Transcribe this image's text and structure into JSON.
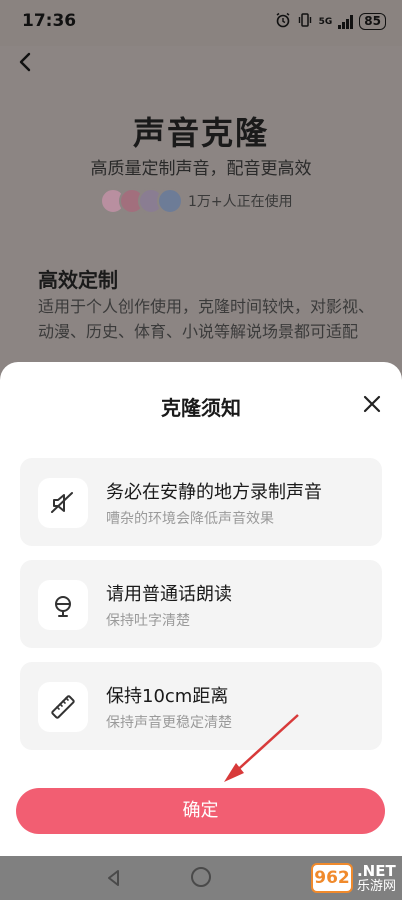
{
  "status_bar": {
    "time": "17:36",
    "network": "5G",
    "battery": "85"
  },
  "background_page": {
    "title": "声音克隆",
    "subtitle": "高质量定制声音，配音更高效",
    "users_text": "1万+人正在使用",
    "section_title": "高效定制",
    "section_desc": "适用于个人创作使用，克隆时间较快，对影视、动漫、历史、体育、小说等解说场景都可适配"
  },
  "sheet": {
    "title": "克隆须知",
    "cards": [
      {
        "icon": "muted-speaker-icon",
        "title": "务必在安静的地方录制声音",
        "subtitle": "嘈杂的环境会降低声音效果"
      },
      {
        "icon": "microphone-icon",
        "title": "请用普通话朗读",
        "subtitle": "保持吐字清楚"
      },
      {
        "icon": "ruler-icon",
        "title": "保持10cm距离",
        "subtitle": "保持声音更稳定清楚"
      }
    ],
    "confirm_label": "确定"
  },
  "watermark": {
    "number": "962",
    "domain": ".NET",
    "cn": "乐游网"
  },
  "colors": {
    "accent": "#f25e72",
    "card_bg": "#f4f4f4",
    "overlay": "#8c8583",
    "annotation_arrow": "#d83a3a"
  }
}
